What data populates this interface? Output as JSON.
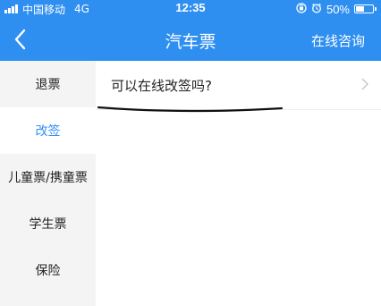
{
  "status_bar": {
    "carrier": "中国移动",
    "network": "4G",
    "time": "12:35",
    "battery_percent": "50%",
    "battery_level": 0.5,
    "icons": [
      "signal-icon",
      "orientation-lock-icon",
      "alarm-icon",
      "battery-icon"
    ]
  },
  "nav": {
    "back_icon": "chevron-left-icon",
    "title": "汽车票",
    "action_label": "在线咨询"
  },
  "sidebar": {
    "items": [
      {
        "label": "退票",
        "active": false
      },
      {
        "label": "改签",
        "active": true
      },
      {
        "label": "儿童票/携童票",
        "active": false
      },
      {
        "label": "学生票",
        "active": false
      },
      {
        "label": "保险",
        "active": false
      }
    ]
  },
  "content": {
    "questions": [
      {
        "text": "可以在线改签吗?"
      }
    ]
  },
  "colors": {
    "accent": "#2f8ff0",
    "sidebar_bg": "#f4f4f5",
    "text": "#222222"
  }
}
